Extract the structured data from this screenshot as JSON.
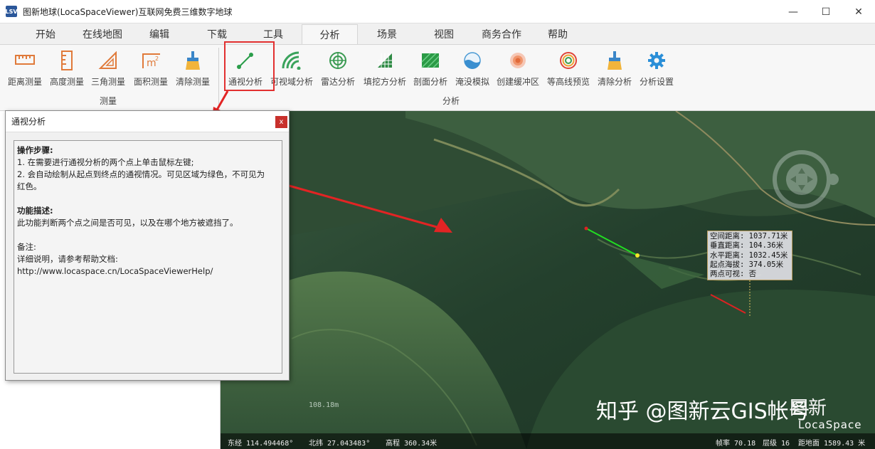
{
  "window": {
    "title": "图新地球(LocaSpaceViewer)互联网免费三维数字地球",
    "logo": "LSV",
    "controls": [
      "minimize-icon",
      "maximize-icon",
      "close-icon"
    ]
  },
  "menu": {
    "tabs": [
      "开始",
      "在线地图",
      "编辑",
      "下载",
      "工具",
      "分析",
      "场景",
      "视图",
      "商务合作",
      "帮助"
    ],
    "active": "分析"
  },
  "ribbon": {
    "groups": {
      "measure": "测量",
      "analysis": "分析"
    },
    "buttons": [
      {
        "label": "距离测量",
        "icon": "ruler-icon"
      },
      {
        "label": "高度测量",
        "icon": "height-ruler-icon"
      },
      {
        "label": "三角测量",
        "icon": "triangle-ruler-icon"
      },
      {
        "label": "面积测量",
        "icon": "area-m2-icon"
      },
      {
        "label": "清除测量",
        "icon": "brush-icon"
      },
      {
        "label": "通视分析",
        "icon": "line-of-sight-icon"
      },
      {
        "label": "可视域分析",
        "icon": "viewshed-icon"
      },
      {
        "label": "雷达分析",
        "icon": "radar-icon"
      },
      {
        "label": "填挖方分析",
        "icon": "cut-fill-icon"
      },
      {
        "label": "剖面分析",
        "icon": "profile-icon"
      },
      {
        "label": "淹没模拟",
        "icon": "flood-icon"
      },
      {
        "label": "创建缓冲区",
        "icon": "buffer-icon"
      },
      {
        "label": "等高线预览",
        "icon": "contour-icon"
      },
      {
        "label": "清除分析",
        "icon": "brush-icon"
      },
      {
        "label": "分析设置",
        "icon": "gear-icon"
      }
    ]
  },
  "dialog": {
    "title": "通视分析",
    "close": "x",
    "steps_heading": "操作步骤:",
    "step1": "1. 在需要进行通视分析的两个点上单击鼠标左键;",
    "step2a": "2. 会自动绘制从起点到终点的通视情况。可见区域为绿色，不可见为",
    "step2b": "红色。",
    "desc_heading": "功能描述:",
    "desc": "此功能判断两个点之间是否可见，以及在哪个地方被遮挡了。",
    "note_heading": "备注:",
    "note1": "详细说明，请参考帮助文档:",
    "note2": "http://www.locaspace.cn/LocaSpaceViewerHelp/"
  },
  "measurement": {
    "space_dist": "空间距离: 1037.71米",
    "vert_dist": "垂直距离: 104.36米",
    "horiz_dist": "水平距离: 1032.45米",
    "start_alt": "起点海拔: 374.05米",
    "visible": "两点可视: 否"
  },
  "status": {
    "lon": "东经 114.494468°",
    "lat": "北纬 27.043483°",
    "alt": "高程 360.34米",
    "fps": "帧率 70.18",
    "level": "层级 16",
    "ground": "距地面 1589.43 米"
  },
  "scale": "108.18m",
  "watermark": "知乎 @图新云GIS帐号",
  "brand": {
    "cn": "图新",
    "en": "LocaSpace"
  },
  "colors": {
    "highlight": "#e23030",
    "visible_line": "#22dd22",
    "blocked_line": "#dd2222"
  }
}
